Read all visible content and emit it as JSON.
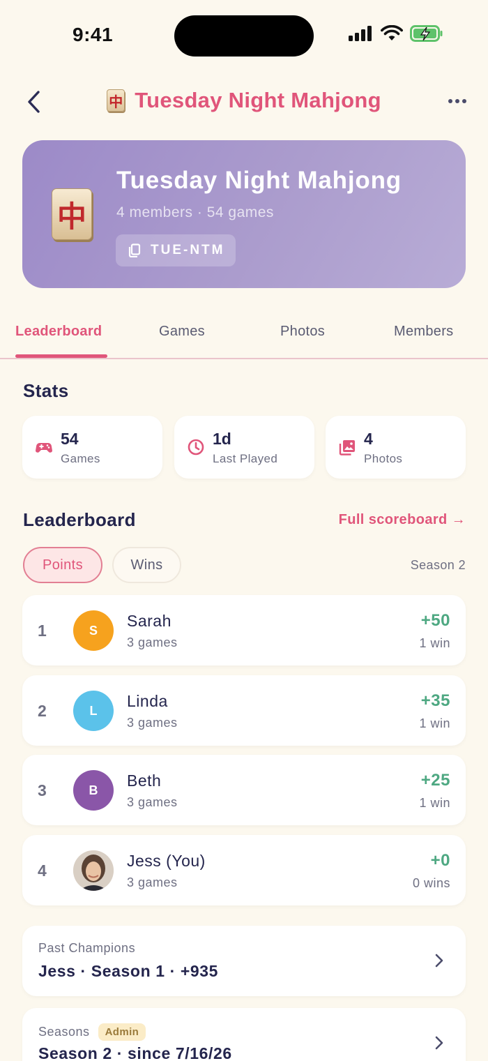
{
  "status_bar": {
    "time": "9:41"
  },
  "nav": {
    "title": "Tuesday Night Mahjong",
    "tile_glyph": "中"
  },
  "group": {
    "name": "Tuesday Night Mahjong",
    "subtitle": "4 members · 54 games",
    "code": "TUE-NTM",
    "tile_glyph": "中"
  },
  "tabs": [
    {
      "label": "Leaderboard",
      "active": true
    },
    {
      "label": "Games",
      "active": false
    },
    {
      "label": "Photos",
      "active": false
    },
    {
      "label": "Members",
      "active": false
    }
  ],
  "stats": {
    "title": "Stats",
    "cards": [
      {
        "value": "54",
        "label": "Games",
        "icon": "gamepad-icon"
      },
      {
        "value": "1d",
        "label": "Last Played",
        "icon": "clock-icon"
      },
      {
        "value": "4",
        "label": "Photos",
        "icon": "photos-icon"
      }
    ]
  },
  "leaderboard": {
    "title": "Leaderboard",
    "full_link": "Full scoreboard →",
    "filters": {
      "points": "Points",
      "wins": "Wins",
      "active": "Points"
    },
    "season": "Season 2",
    "rows": [
      {
        "rank": "1",
        "initial": "S",
        "name": "Sarah",
        "games": "3 games",
        "score": "+50",
        "wins": "1 win",
        "avatar_color": "#f6a21e"
      },
      {
        "rank": "2",
        "initial": "L",
        "name": "Linda",
        "games": "3 games",
        "score": "+35",
        "wins": "1 win",
        "avatar_color": "#5bc2ea"
      },
      {
        "rank": "3",
        "initial": "B",
        "name": "Beth",
        "games": "3 games",
        "score": "+25",
        "wins": "1 win",
        "avatar_color": "#8a56a8"
      },
      {
        "rank": "4",
        "initial": "",
        "name": "Jess (You)",
        "games": "3 games",
        "score": "+0",
        "wins": "0 wins",
        "avatar_color": "#7a6250"
      }
    ]
  },
  "past_champions": {
    "label": "Past Champions",
    "value": "Jess · Season 1 · +935"
  },
  "seasons": {
    "label": "Seasons",
    "badge": "Admin",
    "value": "Season 2 · since 7/16/26"
  },
  "colors": {
    "accent": "#e0557a",
    "positive": "#4ea882",
    "header_gradient": "#9c8ac8"
  }
}
